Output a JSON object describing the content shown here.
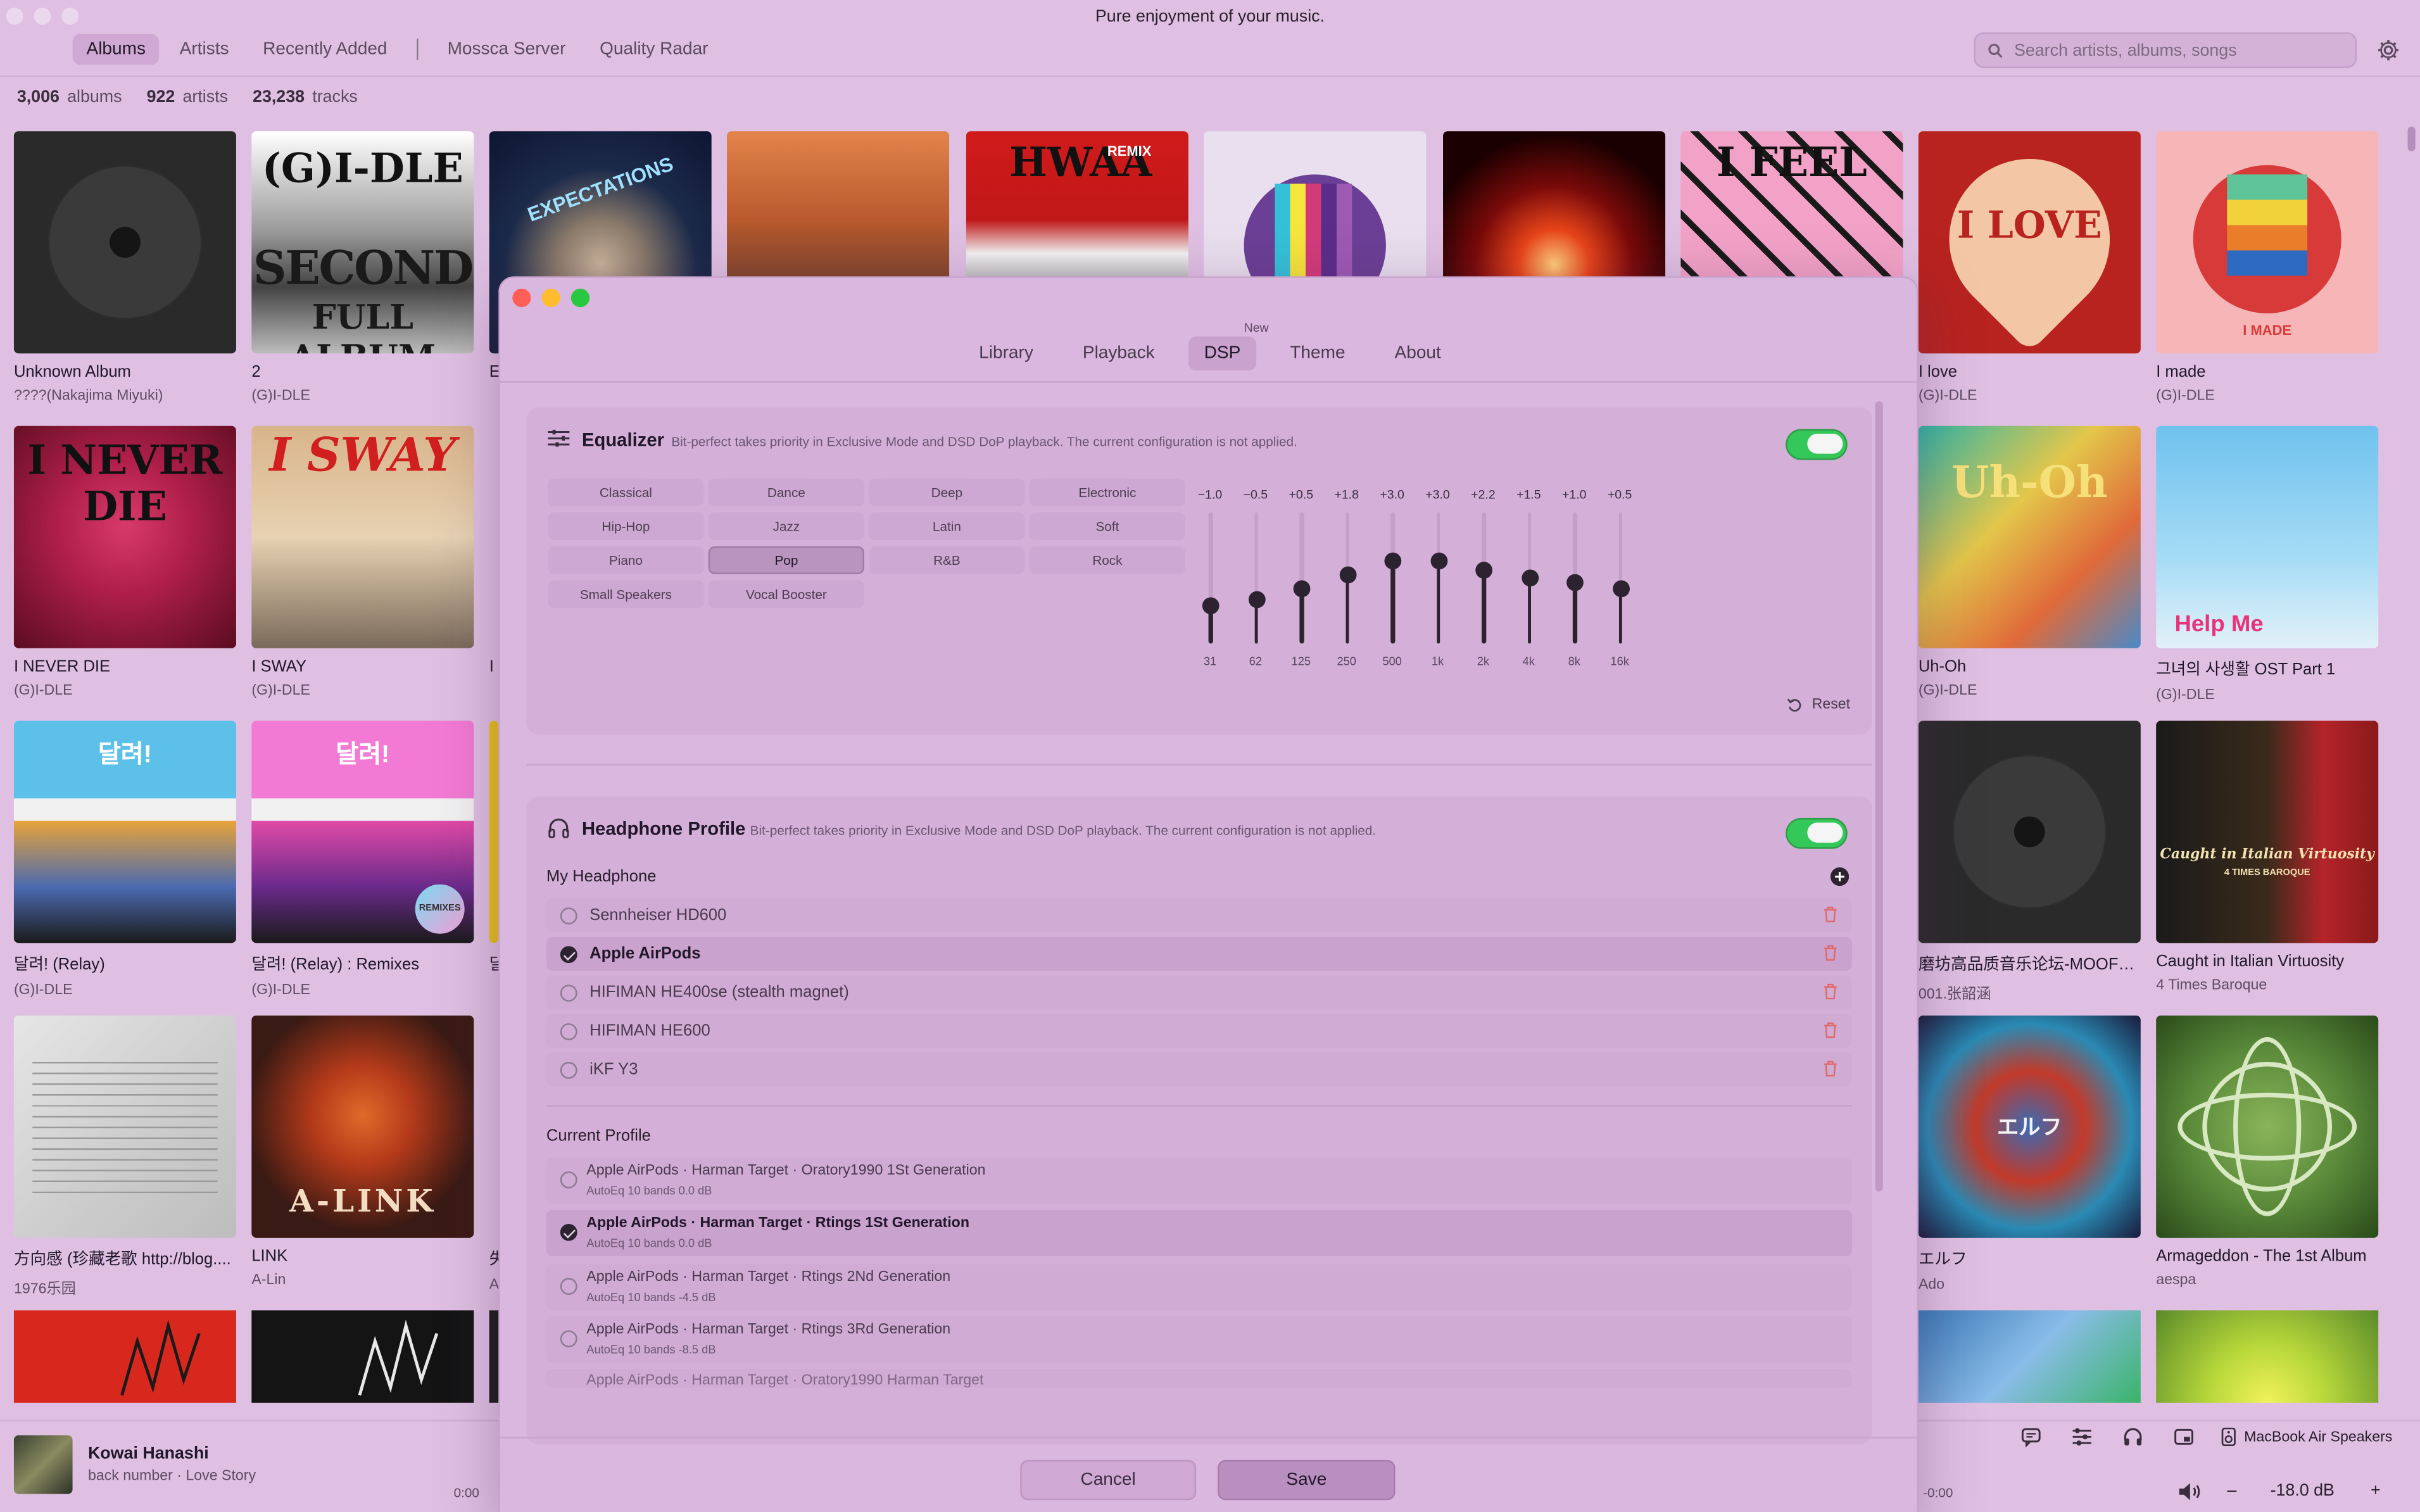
{
  "window": {
    "title": "Pure enjoyment of your music."
  },
  "nav": {
    "tabs": [
      "Albums",
      "Artists",
      "Recently Added"
    ],
    "tabs2": [
      "Mossca Server",
      "Quality Radar"
    ],
    "active": "Albums"
  },
  "search": {
    "placeholder": "Search artists, albums, songs"
  },
  "stats": {
    "albums_count": "3,006",
    "albums_unit": "albums",
    "artists_count": "922",
    "artists_unit": "artists",
    "tracks_count": "23,238",
    "tracks_unit": "tracks"
  },
  "albums": [
    {
      "title": "Unknown Album",
      "artist": "????(Nakajima Miyuki)"
    },
    {
      "title": "2",
      "artist": "(G)I-DLE"
    },
    {
      "title": "I love",
      "artist": "(G)I-DLE"
    },
    {
      "title": "I made",
      "artist": "(G)I-DLE"
    },
    {
      "title": "I NEVER DIE",
      "artist": "(G)I-DLE"
    },
    {
      "title": "I SWAY",
      "artist": "(G)I-DLE"
    },
    {
      "title": "Uh-Oh",
      "artist": "(G)I-DLE"
    },
    {
      "title": "그녀의 사생활 OST Part 1",
      "artist": "(G)I-DLE"
    },
    {
      "title": "달려! (Relay)",
      "artist": "(G)I-DLE"
    },
    {
      "title": "달려! (Relay) : Remixes",
      "artist": "(G)I-DLE"
    },
    {
      "title": "磨坊高品质音乐论坛-MOOFEE...",
      "artist": "001.张韶涵"
    },
    {
      "title": "Caught in Italian Virtuosity",
      "artist": "4 Times Baroque"
    },
    {
      "title": "方向感 (珍藏老歌 http://blog....",
      "artist": "1976乐园"
    },
    {
      "title": "LINK",
      "artist": "A-Lin"
    },
    {
      "title": "エルフ",
      "artist": "Ado"
    },
    {
      "title": "Armageddon - The 1st Album",
      "artist": "aespa"
    }
  ],
  "partial_labels": {
    "row1": "E",
    "row2": "I",
    "row3": "달",
    "row4_title": "失",
    "row4_artist": "A"
  },
  "cover_texts": {
    "c2a": "(G)I-DLE",
    "c2b": "SECOND",
    "c2c": "FULL ALBUM",
    "c3": "EXPECTATIONS",
    "c5": "HWAA",
    "c5b": "REMIX",
    "c8": "I FEEL",
    "c9": "I LOVE",
    "c10": "I MADE",
    "r2a": "I NEVER",
    "r2b": "DIE",
    "r2c": "I SWAY",
    "r2d": "Uh-Oh",
    "r2e": "Help Me",
    "r3a": "달려!",
    "r3b": "달려!",
    "r3c": "REMIXES",
    "r3d": "Caught in Italian Virtuosity",
    "r3e": "4 TIMES BAROQUE",
    "r4a": "A-LINK",
    "r4b": "エルフ"
  },
  "player": {
    "title": "Kowai Hanashi",
    "subtitle": "back number · Love Story",
    "time_left": "0:00",
    "time_right": "-0:00",
    "output": "MacBook Air Speakers",
    "volume": "-18.0 dB",
    "vol_minus": "–",
    "vol_plus": "+"
  },
  "modal": {
    "tabs": [
      "Library",
      "Playback",
      "DSP",
      "Theme",
      "About"
    ],
    "active_tab": "DSP",
    "new_badge": "New",
    "equalizer": {
      "title": "Equalizer",
      "note": "Bit-perfect takes priority in Exclusive Mode and DSD DoP playback. The current configuration is not applied.",
      "enabled": true,
      "presets": [
        "Classical",
        "Dance",
        "Deep",
        "Electronic",
        "Hip-Hop",
        "Jazz",
        "Latin",
        "Soft",
        "Piano",
        "Pop",
        "R&B",
        "Rock",
        "Small Speakers",
        "Vocal Booster"
      ],
      "selected_preset": "Pop",
      "bands": [
        {
          "freq": "31",
          "gain_label": "−1.0",
          "gain": -1.0
        },
        {
          "freq": "62",
          "gain_label": "−0.5",
          "gain": -0.5
        },
        {
          "freq": "125",
          "gain_label": "+0.5",
          "gain": 0.5
        },
        {
          "freq": "250",
          "gain_label": "+1.8",
          "gain": 1.8
        },
        {
          "freq": "500",
          "gain_label": "+3.0",
          "gain": 3.0
        },
        {
          "freq": "1k",
          "gain_label": "+3.0",
          "gain": 3.0
        },
        {
          "freq": "2k",
          "gain_label": "+2.2",
          "gain": 2.2
        },
        {
          "freq": "4k",
          "gain_label": "+1.5",
          "gain": 1.5
        },
        {
          "freq": "8k",
          "gain_label": "+1.0",
          "gain": 1.0
        },
        {
          "freq": "16k",
          "gain_label": "+0.5",
          "gain": 0.5
        }
      ],
      "reset_label": "Reset"
    },
    "headphone": {
      "title": "Headphone Profile",
      "note": "Bit-perfect takes priority in Exclusive Mode and DSD DoP playback. The current configuration is not applied.",
      "enabled": true,
      "my_headphone_label": "My Headphone",
      "headphones": [
        "Sennheiser HD600",
        "Apple AirPods",
        "HIFIMAN HE400se (stealth magnet)",
        "HIFIMAN HE600",
        "iKF Y3"
      ],
      "selected_headphone": "Apple AirPods",
      "current_profile_label": "Current Profile",
      "profiles": [
        {
          "title": "Apple AirPods · Harman Target · Oratory1990 1St Generation",
          "sub": "AutoEq  10 bands  0.0 dB"
        },
        {
          "title": "Apple AirPods · Harman Target · Rtings 1St Generation",
          "sub": "AutoEq  10 bands  0.0 dB"
        },
        {
          "title": "Apple AirPods · Harman Target · Rtings 2Nd Generation",
          "sub": "AutoEq  10 bands  -4.5 dB"
        },
        {
          "title": "Apple AirPods · Harman Target · Rtings 3Rd Generation",
          "sub": "AutoEq  10 bands  -8.5 dB"
        },
        {
          "title": "Apple AirPods · Harman Target · Oratory1990 Harman Target",
          "sub": ""
        }
      ],
      "selected_profile": 1
    },
    "cancel_label": "Cancel",
    "save_label": "Save"
  },
  "colors": {
    "background": "#dfc0e2",
    "accent_toggle": "#34c759",
    "close": "#ff5f57",
    "minimize": "#febc2e",
    "maximize": "#28c840"
  }
}
